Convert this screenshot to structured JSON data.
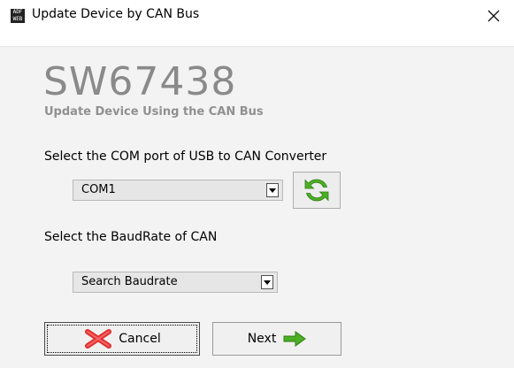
{
  "window": {
    "title": "Update Device by CAN Bus",
    "icon": "adfweb-app-icon",
    "close_icon": "close-icon"
  },
  "header": {
    "app_code": "SW67438",
    "subtitle": "Update Device Using the CAN Bus"
  },
  "com_port": {
    "label": "Select the COM port of USB to CAN Converter",
    "selected": "COM1",
    "refresh_icon": "refresh-icon"
  },
  "baudrate": {
    "label": "Select the BaudRate of CAN",
    "selected": "Search Baudrate"
  },
  "buttons": {
    "cancel_label": "Cancel",
    "cancel_icon": "red-x-icon",
    "next_label": "Next",
    "next_icon": "green-arrow-right-icon"
  },
  "colors": {
    "content_bg": "#f3f3f3",
    "title_gray": "#8a8a8a",
    "cancel_red": "#e03030",
    "next_green": "#4caf24"
  }
}
